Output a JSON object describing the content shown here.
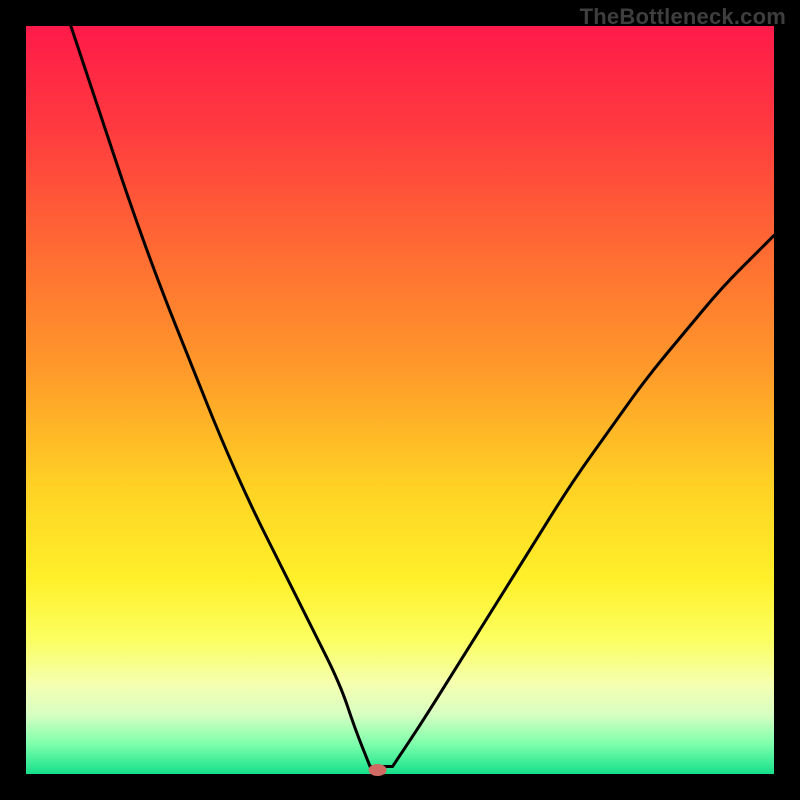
{
  "watermark": "TheBottleneck.com",
  "gradient": {
    "stops": [
      {
        "pct": 0,
        "color": "#ff1a49"
      },
      {
        "pct": 14,
        "color": "#ff3b3f"
      },
      {
        "pct": 30,
        "color": "#ff6b33"
      },
      {
        "pct": 46,
        "color": "#ff9a2a"
      },
      {
        "pct": 62,
        "color": "#ffd324"
      },
      {
        "pct": 74,
        "color": "#fff02a"
      },
      {
        "pct": 82,
        "color": "#fbff60"
      },
      {
        "pct": 88,
        "color": "#f5ffb0"
      },
      {
        "pct": 92,
        "color": "#d8ffc2"
      },
      {
        "pct": 96,
        "color": "#7effac"
      },
      {
        "pct": 100,
        "color": "#14e08a"
      }
    ]
  },
  "chart_data": {
    "type": "line",
    "title": "",
    "xlabel": "",
    "ylabel": "",
    "xlim": [
      0,
      100
    ],
    "ylim": [
      0,
      100
    ],
    "optimum_x": 47,
    "marker": {
      "x": 47,
      "y": 0,
      "color": "#d06a62"
    },
    "series": [
      {
        "name": "left-branch",
        "x": [
          6,
          10,
          14,
          18,
          22,
          26,
          30,
          34,
          38,
          42,
          44,
          46
        ],
        "values": [
          100,
          88,
          76,
          65,
          55,
          45,
          36,
          28,
          20,
          12,
          6,
          1
        ]
      },
      {
        "name": "flat-valley",
        "x": [
          46,
          49
        ],
        "values": [
          1,
          1
        ]
      },
      {
        "name": "right-branch",
        "x": [
          49,
          53,
          58,
          63,
          68,
          73,
          78,
          83,
          88,
          93,
          98,
          100
        ],
        "values": [
          1,
          7,
          15,
          23,
          31,
          39,
          46,
          53,
          59,
          65,
          70,
          72
        ]
      }
    ]
  }
}
